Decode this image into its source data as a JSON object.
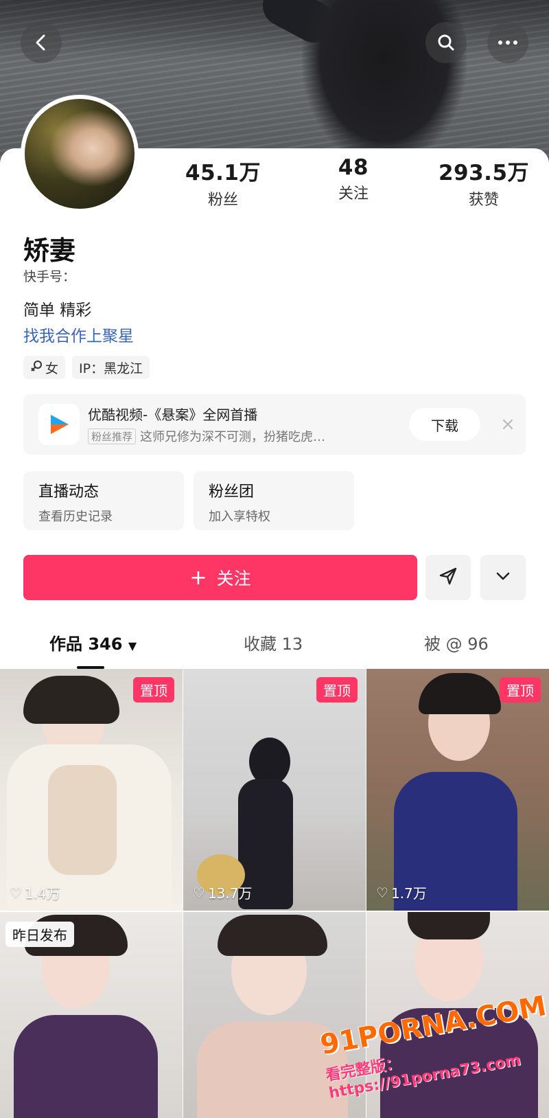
{
  "nav": {
    "back_icon": "back-arrow-icon",
    "search_icon": "search-icon",
    "more_icon": "more-dots-icon"
  },
  "stats": [
    {
      "num": "45.1万",
      "label": "粉丝"
    },
    {
      "num": "48",
      "label": "关注"
    },
    {
      "num": "293.5万",
      "label": "获赞"
    }
  ],
  "profile": {
    "name": "矫妻",
    "kuaishou_id": "快手号：",
    "bio_line1": "简单 精彩",
    "bio_line2": "找我合作上聚星",
    "gender": "女",
    "ip": "IP：黑龙江"
  },
  "ad": {
    "title": "优酷视频-《悬案》全网首播",
    "badge": "粉丝推荐",
    "subtitle": "这师兄修为深不可测，扮猪吃虎…",
    "download": "下载",
    "close": "×"
  },
  "features": [
    {
      "title": "直播动态",
      "sub": "查看历史记录"
    },
    {
      "title": "粉丝团",
      "sub": "加入享特权"
    }
  ],
  "follow": {
    "plus": "+",
    "label": "关注"
  },
  "tabs": [
    {
      "label": "作品 346"
    },
    {
      "label": "收藏 13"
    },
    {
      "label": "被 @ 96"
    }
  ],
  "grid": [
    {
      "pin": "置顶",
      "likes": "1.4万"
    },
    {
      "pin": "置顶",
      "likes": "13.7万"
    },
    {
      "pin": "置顶",
      "likes": "1.7万"
    },
    {
      "badge": "昨日发布"
    },
    {},
    {}
  ],
  "watermark": {
    "line1": "91PORNA.COM",
    "line2": "看完整版：https://91porna73.com"
  },
  "colors": {
    "accent": "#fe3666",
    "link": "#3a64b5"
  }
}
